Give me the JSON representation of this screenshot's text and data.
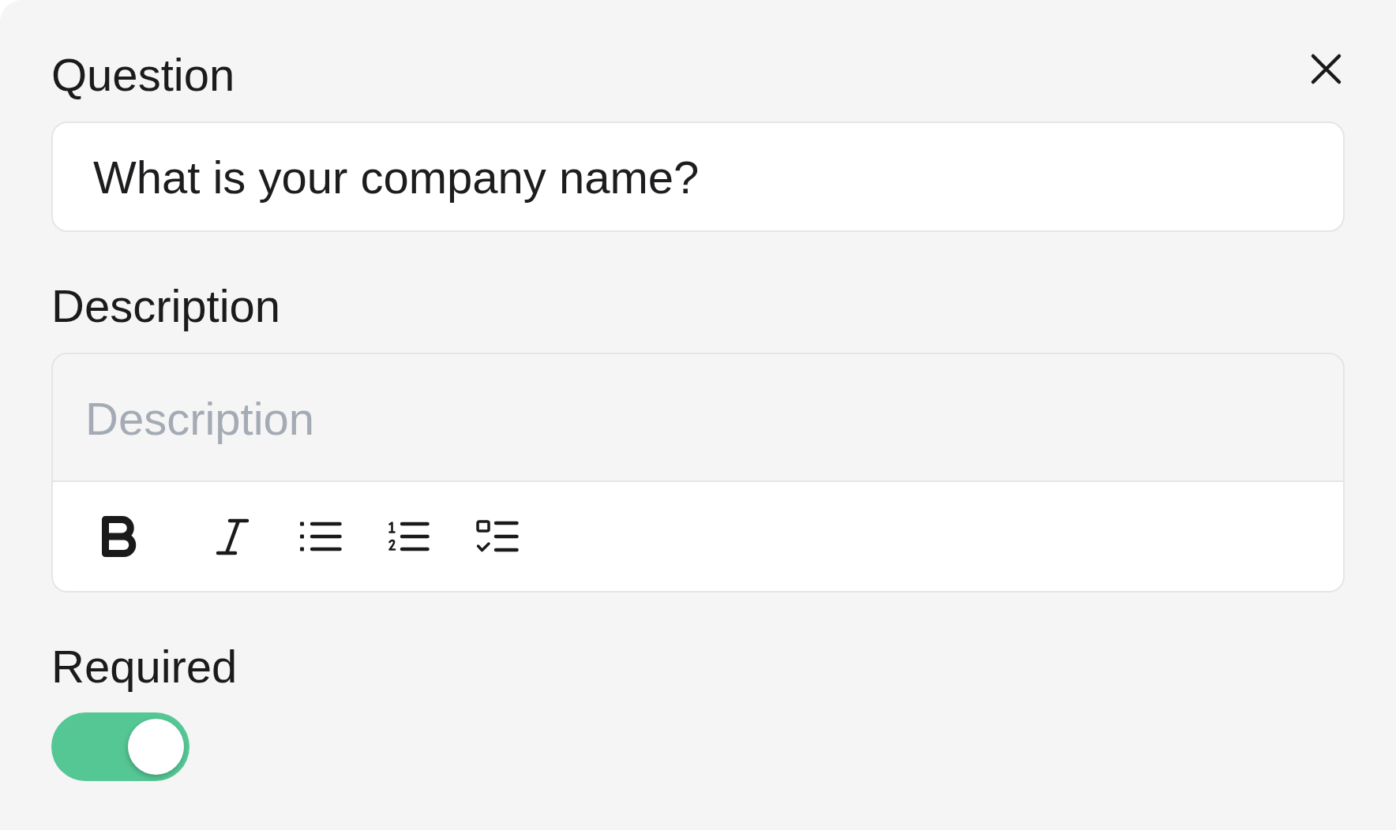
{
  "form": {
    "fields": [
      {
        "kind": "text",
        "label": "Question",
        "value": "What is your company name?"
      },
      {
        "kind": "rich_text",
        "label": "Description",
        "placeholder": "Description",
        "toolbar": [
          {
            "kind": "bold"
          },
          {
            "kind": "italic"
          },
          {
            "kind": "bullet_list"
          },
          {
            "kind": "numbered_list"
          },
          {
            "kind": "checklist"
          }
        ]
      },
      {
        "kind": "toggle",
        "label": "Required",
        "on": true
      }
    ]
  }
}
